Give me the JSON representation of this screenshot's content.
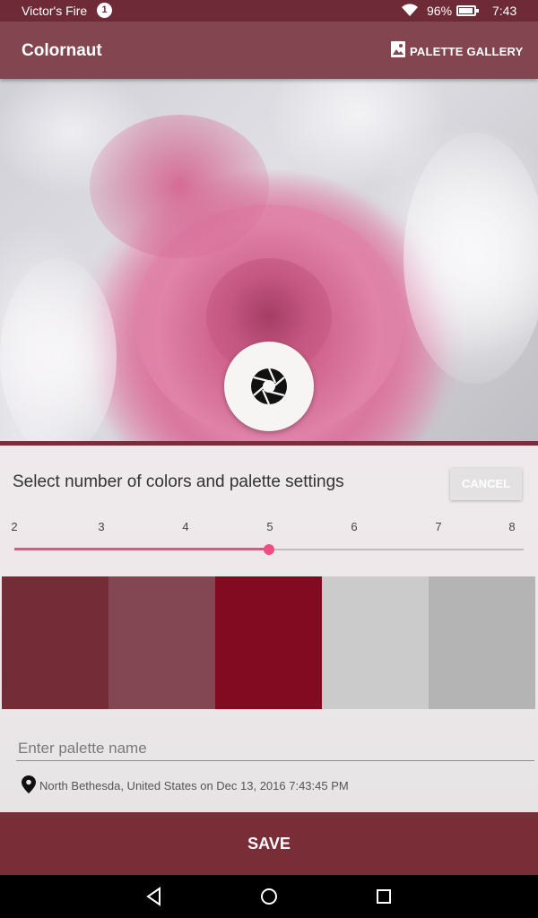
{
  "status_bar": {
    "carrier": "Victor's Fire",
    "notification_count": "1",
    "battery": "96%",
    "time": "7:43"
  },
  "app_bar": {
    "title": "Colornaut",
    "gallery_label": "PALETTE GALLERY"
  },
  "settings": {
    "heading": "Select number of colors and palette settings",
    "cancel_label": "CANCEL",
    "slider": {
      "ticks": [
        "2",
        "3",
        "4",
        "5",
        "6",
        "7",
        "8"
      ],
      "value": 5,
      "min": 2,
      "max": 8
    },
    "swatches": [
      "#742c37",
      "#824753",
      "#820b22",
      "#cbcbcb",
      "#b4b4b4"
    ],
    "name_placeholder": "Enter palette name",
    "location_text": "North Bethesda, United States on Dec 13, 2016 7:43:45 PM"
  },
  "save_label": "SAVE",
  "icons": {
    "shutter": "camera-shutter-icon",
    "gallery": "image-gallery-icon",
    "location": "location-pin-icon",
    "nav_back": "back-icon",
    "nav_home": "home-icon",
    "nav_recents": "recents-icon"
  },
  "colors": {
    "status_bar": "#6e2b37",
    "app_bar": "#834651",
    "accent": "#ef4c82",
    "save_bar": "#782d37"
  }
}
